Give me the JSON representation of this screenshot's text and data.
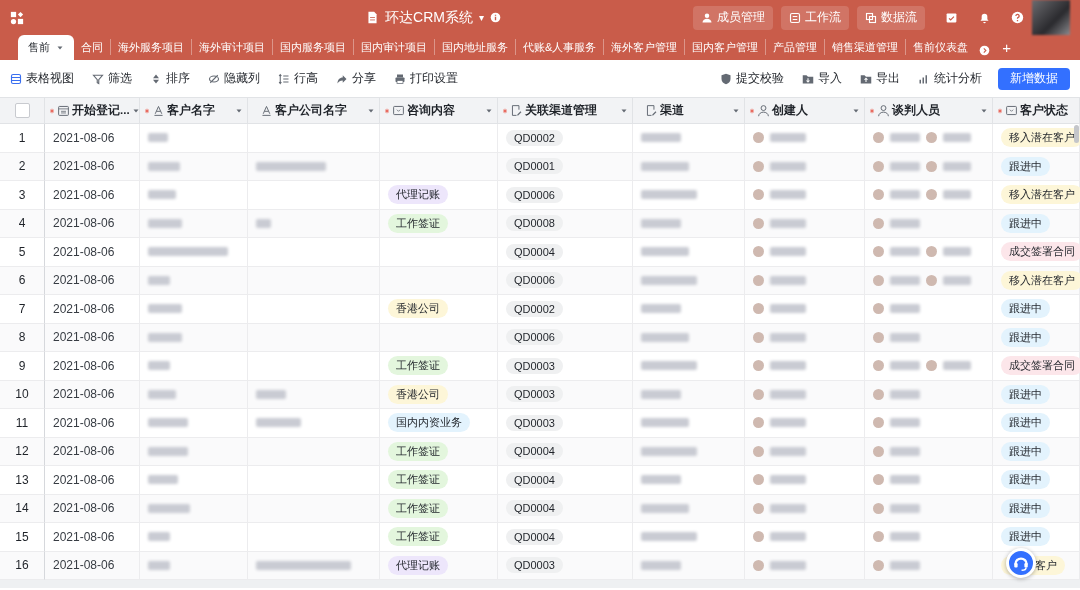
{
  "app": {
    "title": "环达CRM系统",
    "caret": "▾",
    "actions": [
      {
        "label": "成员管理"
      },
      {
        "label": "工作流"
      },
      {
        "label": "数据流"
      }
    ]
  },
  "tabs": [
    {
      "label": "售前",
      "selected": true
    },
    {
      "label": "合同",
      "selected": false
    },
    {
      "label": "海外服务项目",
      "selected": false
    },
    {
      "label": "海外审计项目",
      "selected": false
    },
    {
      "label": "国内服务项目",
      "selected": false
    },
    {
      "label": "国内审计项目",
      "selected": false
    },
    {
      "label": "国内地址服务",
      "selected": false
    },
    {
      "label": "代账&人事服务",
      "selected": false
    },
    {
      "label": "海外客户管理",
      "selected": false
    },
    {
      "label": "国内客户管理",
      "selected": false
    },
    {
      "label": "产品管理",
      "selected": false
    },
    {
      "label": "销售渠道管理",
      "selected": false
    },
    {
      "label": "售前仪表盘",
      "selected": false
    }
  ],
  "add_tab": "+",
  "toolbar": {
    "left": [
      {
        "label": "表格视图"
      },
      {
        "label": "筛选"
      },
      {
        "label": "排序"
      },
      {
        "label": "隐藏列"
      },
      {
        "label": "行高"
      },
      {
        "label": "分享"
      },
      {
        "label": "打印设置"
      }
    ],
    "right": [
      {
        "label": "提交校验"
      },
      {
        "label": "导入"
      },
      {
        "label": "导出"
      },
      {
        "label": "统计分析"
      }
    ],
    "primary": "新增数据"
  },
  "select_all": {
    "checked": false
  },
  "columns": [
    {
      "label": "开始登记...",
      "required": true
    },
    {
      "label": "客户名字",
      "required": true
    },
    {
      "label": "客户公司名字",
      "required": false
    },
    {
      "label": "咨询内容",
      "required": true
    },
    {
      "label": "关联渠道管理",
      "required": true
    },
    {
      "label": "渠道",
      "required": false
    },
    {
      "label": "创建人",
      "required": true
    },
    {
      "label": "谈判人员",
      "required": true
    },
    {
      "label": "客户状态",
      "required": true
    }
  ],
  "rows": [
    {
      "index": "1",
      "date": "2021-08-06",
      "link": "QD0002",
      "status": {
        "label": "移入潜在客户",
        "color": "#fdf6d8"
      }
    },
    {
      "index": "2",
      "date": "2021-08-06",
      "link": "QD0001",
      "status": {
        "label": "跟进中",
        "color": "#e3f3fd"
      }
    },
    {
      "index": "3",
      "date": "2021-08-06",
      "consult": {
        "label": "代理记账",
        "color": "#ede6fb"
      },
      "link": "QD0006",
      "status": {
        "label": "移入潜在客户",
        "color": "#fdf6d8"
      }
    },
    {
      "index": "4",
      "date": "2021-08-06",
      "consult": {
        "label": "工作签证",
        "color": "#e3f6dd"
      },
      "link": "QD0008",
      "status": {
        "label": "跟进中",
        "color": "#e3f3fd"
      }
    },
    {
      "index": "5",
      "date": "2021-08-06",
      "link": "QD0004",
      "status": {
        "label": "成交签署合同",
        "color": "#fce6ea"
      }
    },
    {
      "index": "6",
      "date": "2021-08-06",
      "link": "QD0006",
      "status": {
        "label": "移入潜在客户",
        "color": "#fdf6d8"
      }
    },
    {
      "index": "7",
      "date": "2021-08-06",
      "consult": {
        "label": "香港公司",
        "color": "#fdf6d8"
      },
      "link": "QD0002",
      "status": {
        "label": "跟进中",
        "color": "#e3f3fd"
      }
    },
    {
      "index": "8",
      "date": "2021-08-06",
      "link": "QD0006",
      "status": {
        "label": "跟进中",
        "color": "#e3f3fd"
      }
    },
    {
      "index": "9",
      "date": "2021-08-06",
      "consult": {
        "label": "工作签证",
        "color": "#e3f6dd"
      },
      "link": "QD0003",
      "status": {
        "label": "成交签署合同",
        "color": "#fce6ea"
      }
    },
    {
      "index": "10",
      "date": "2021-08-06",
      "consult": {
        "label": "香港公司",
        "color": "#fdf6d8"
      },
      "link": "QD0003",
      "status": {
        "label": "跟进中",
        "color": "#e3f3fd"
      }
    },
    {
      "index": "11",
      "date": "2021-08-06",
      "consult": {
        "label": "国内内资业务",
        "color": "#e3f3fd"
      },
      "link": "QD0003",
      "status": {
        "label": "跟进中",
        "color": "#e3f3fd"
      }
    },
    {
      "index": "12",
      "date": "2021-08-06",
      "consult": {
        "label": "工作签证",
        "color": "#e3f6dd"
      },
      "link": "QD0004",
      "status": {
        "label": "跟进中",
        "color": "#e3f3fd"
      }
    },
    {
      "index": "13",
      "date": "2021-08-06",
      "consult": {
        "label": "工作签证",
        "color": "#e3f6dd"
      },
      "link": "QD0004",
      "status": {
        "label": "跟进中",
        "color": "#e3f3fd"
      }
    },
    {
      "index": "14",
      "date": "2021-08-06",
      "consult": {
        "label": "工作签证",
        "color": "#e3f6dd"
      },
      "link": "QD0004",
      "status": {
        "label": "跟进中",
        "color": "#e3f3fd"
      }
    },
    {
      "index": "15",
      "date": "2021-08-06",
      "consult": {
        "label": "工作签证",
        "color": "#e3f6dd"
      },
      "link": "QD0004",
      "status": {
        "label": "跟进中",
        "color": "#e3f3fd"
      }
    },
    {
      "index": "16",
      "date": "2021-08-06",
      "consult": {
        "label": "代理记账",
        "color": "#ede6fb"
      },
      "link": "QD0003",
      "status": {
        "label": "客户",
        "color": "#fdf6d8",
        "covered": true
      }
    }
  ]
}
